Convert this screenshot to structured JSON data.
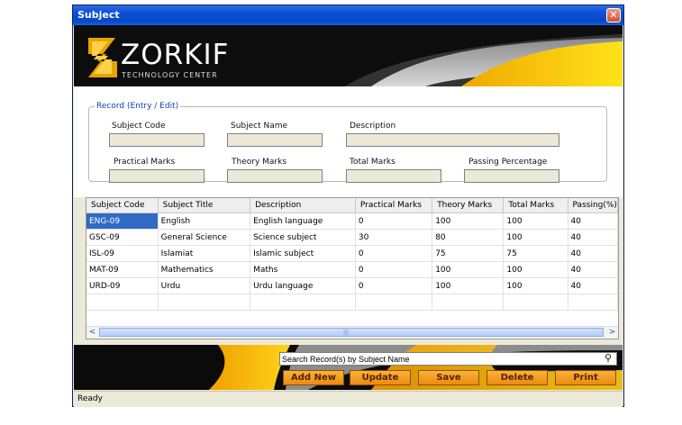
{
  "window": {
    "title": "Subject",
    "close_symbol": "✕"
  },
  "banner": {
    "logo_main": "ZORKIF",
    "logo_sub": "TECHNOLOGY CENTER"
  },
  "form": {
    "legend": "Record (Entry / Edit)",
    "labels": {
      "subject_code": "Subject Code",
      "subject_name": "Subject Name",
      "description": "Description",
      "practical_marks": "Practical Marks",
      "theory_marks": "Theory Marks",
      "total_marks": "Total Marks",
      "passing_percentage": "Passing Percentage"
    },
    "values": {
      "subject_code": "",
      "subject_name": "",
      "description": "",
      "practical_marks": "",
      "theory_marks": "",
      "total_marks": "",
      "passing_percentage": ""
    }
  },
  "table": {
    "columns": [
      "Subject Code",
      "Subject Title",
      "Description",
      "Practical Marks",
      "Theory Marks",
      "Total Marks",
      "Passing(%)"
    ],
    "rows": [
      [
        "ENG-09",
        "English",
        "English language",
        "0",
        "100",
        "100",
        "40"
      ],
      [
        "GSC-09",
        "General Science",
        "Science subject",
        "30",
        "80",
        "100",
        "40"
      ],
      [
        "ISL-09",
        "Islamiat",
        "Islamic subject",
        "0",
        "75",
        "75",
        "40"
      ],
      [
        "MAT-09",
        "Mathematics",
        "Maths",
        "0",
        "100",
        "100",
        "40"
      ],
      [
        "URD-09",
        "Urdu",
        "Urdu language",
        "0",
        "100",
        "100",
        "40"
      ]
    ],
    "selected_row": 0,
    "scroll_left": "<",
    "scroll_right": ">",
    "scroll_grip": "|||"
  },
  "toolbar": {
    "search_placeholder": "Search Record(s) by Subject Name",
    "search_icon": "binoculars-icon",
    "search_glyph": "⚲",
    "add_new": "Add New",
    "update": "Update",
    "save": "Save",
    "delete": "Delete",
    "print": "Print"
  },
  "status": {
    "text": "Ready"
  },
  "colors": {
    "accent": "#f7c200",
    "button": "#ec8a10",
    "title_bar": "#0a4fd6",
    "selection": "#316ac5"
  }
}
